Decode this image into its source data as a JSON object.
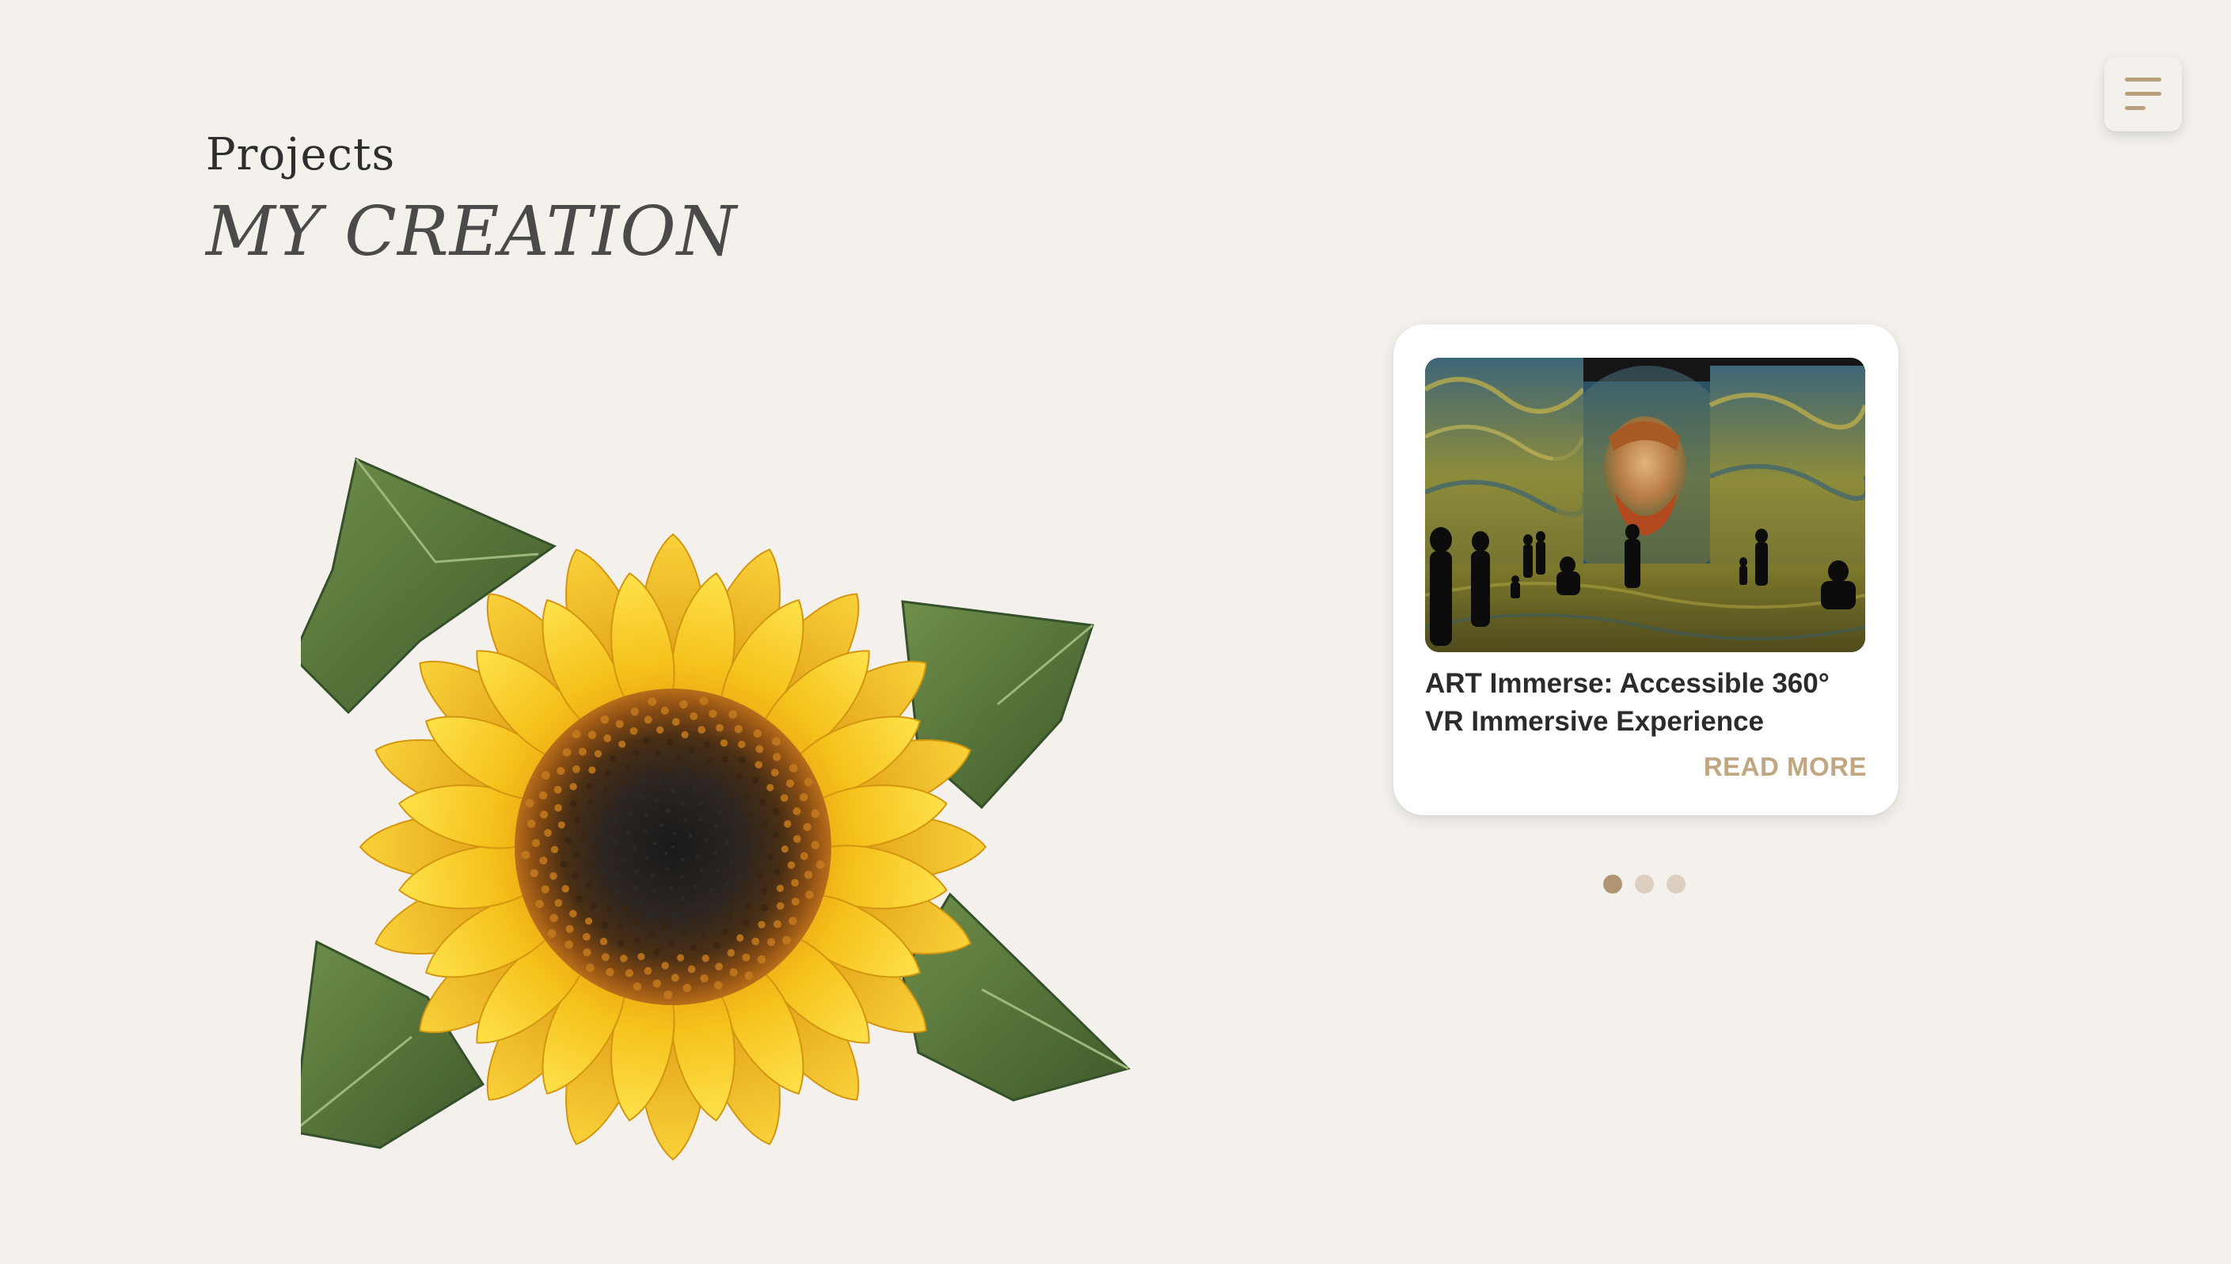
{
  "menu": {
    "icon": "hamburger-menu-icon",
    "color": "#b8a07c"
  },
  "header": {
    "eyebrow": "Projects",
    "title": "MY CREATION"
  },
  "hero_image": {
    "subject": "sunflower"
  },
  "carousel": {
    "cards": [
      {
        "title": "ART Immerse: Accessible 360° VR Immersive Experience",
        "cta": "READ MORE",
        "image": "immersive-gallery-self-portrait"
      }
    ],
    "pagination": {
      "count": 3,
      "active": 1,
      "active_color": "#b09574",
      "inactive_color": "#dccfbf"
    }
  },
  "colors": {
    "background": "#f4f1ed",
    "accent": "#c0a681",
    "card_bg": "#ffffff"
  }
}
